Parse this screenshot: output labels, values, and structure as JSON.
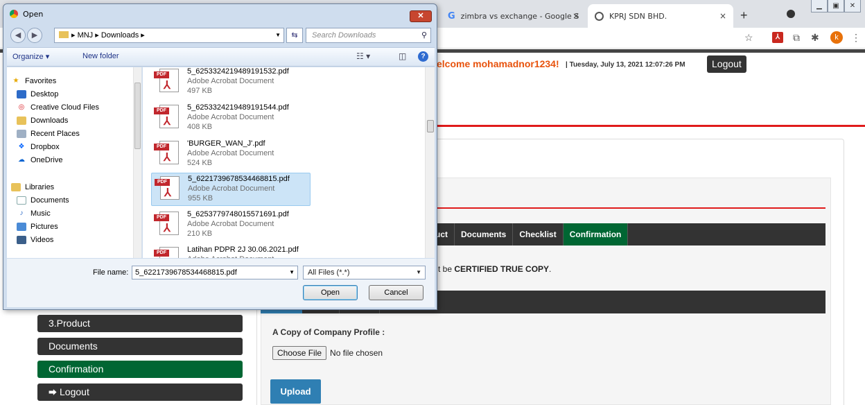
{
  "browser": {
    "tabs": [
      {
        "label": "zimbra vs exchange - Google S"
      },
      {
        "label": "KPRJ SDN BHD."
      }
    ],
    "new_tab": "+",
    "close_tab": "×"
  },
  "page": {
    "welcome": "elcome mohamadnor1234!",
    "datetime": "| Tuesday, July 13, 2021 12:07:26 PM",
    "logout_top": "Logout",
    "nav": [
      {
        "label": "uct"
      },
      {
        "label": "Documents"
      },
      {
        "label": "Checklist"
      },
      {
        "label": "Confirmation"
      }
    ],
    "certified_prefix": "t be ",
    "certified_bold": "CERTIFIED TRUE COPY",
    "certified_suffix": ".",
    "copy_label": "A Copy of Company Profile :",
    "choose_file": "Choose File",
    "no_file": "No file chosen",
    "upload": "Upload",
    "sidebar": [
      {
        "label": "3.Product"
      },
      {
        "label": "Documents"
      },
      {
        "label": "Confirmation"
      },
      {
        "label": "Logout"
      }
    ]
  },
  "dialog": {
    "title": "Open",
    "breadcrumb": "▸ MNJ ▸ Downloads ▸",
    "search_placeholder": "Search Downloads",
    "organize": "Organize ▾",
    "new_folder": "New folder",
    "nav_items": [
      {
        "label": "Favorites"
      },
      {
        "label": "Desktop"
      },
      {
        "label": "Creative Cloud Files"
      },
      {
        "label": "Downloads"
      },
      {
        "label": "Recent Places"
      },
      {
        "label": "Dropbox"
      },
      {
        "label": "OneDrive"
      },
      {
        "label": "Libraries"
      },
      {
        "label": "Documents"
      },
      {
        "label": "Music"
      },
      {
        "label": "Pictures"
      },
      {
        "label": "Videos"
      }
    ],
    "files": [
      {
        "name": "5_6253324219489191532.pdf",
        "type": "Adobe Acrobat Document",
        "size": "497 KB"
      },
      {
        "name": "5_6253324219489191544.pdf",
        "type": "Adobe Acrobat Document",
        "size": "408 KB"
      },
      {
        "name": "'BURGER_WAN_J'.pdf",
        "type": "Adobe Acrobat Document",
        "size": "524 KB"
      },
      {
        "name": "5_6221739678534468815.pdf",
        "type": "Adobe Acrobat Document",
        "size": "955 KB"
      },
      {
        "name": "5_6253779748015571691.pdf",
        "type": "Adobe Acrobat Document",
        "size": "210 KB"
      },
      {
        "name": "Latihan PDPR 2J 30.06.2021.pdf",
        "type": "Adobe Acrobat Document",
        "size": ""
      }
    ],
    "file_name_label": "File name:",
    "file_name_value": "5_6221739678534468815.pdf",
    "filter": "All Files (*.*)",
    "open": "Open",
    "cancel": "Cancel"
  }
}
